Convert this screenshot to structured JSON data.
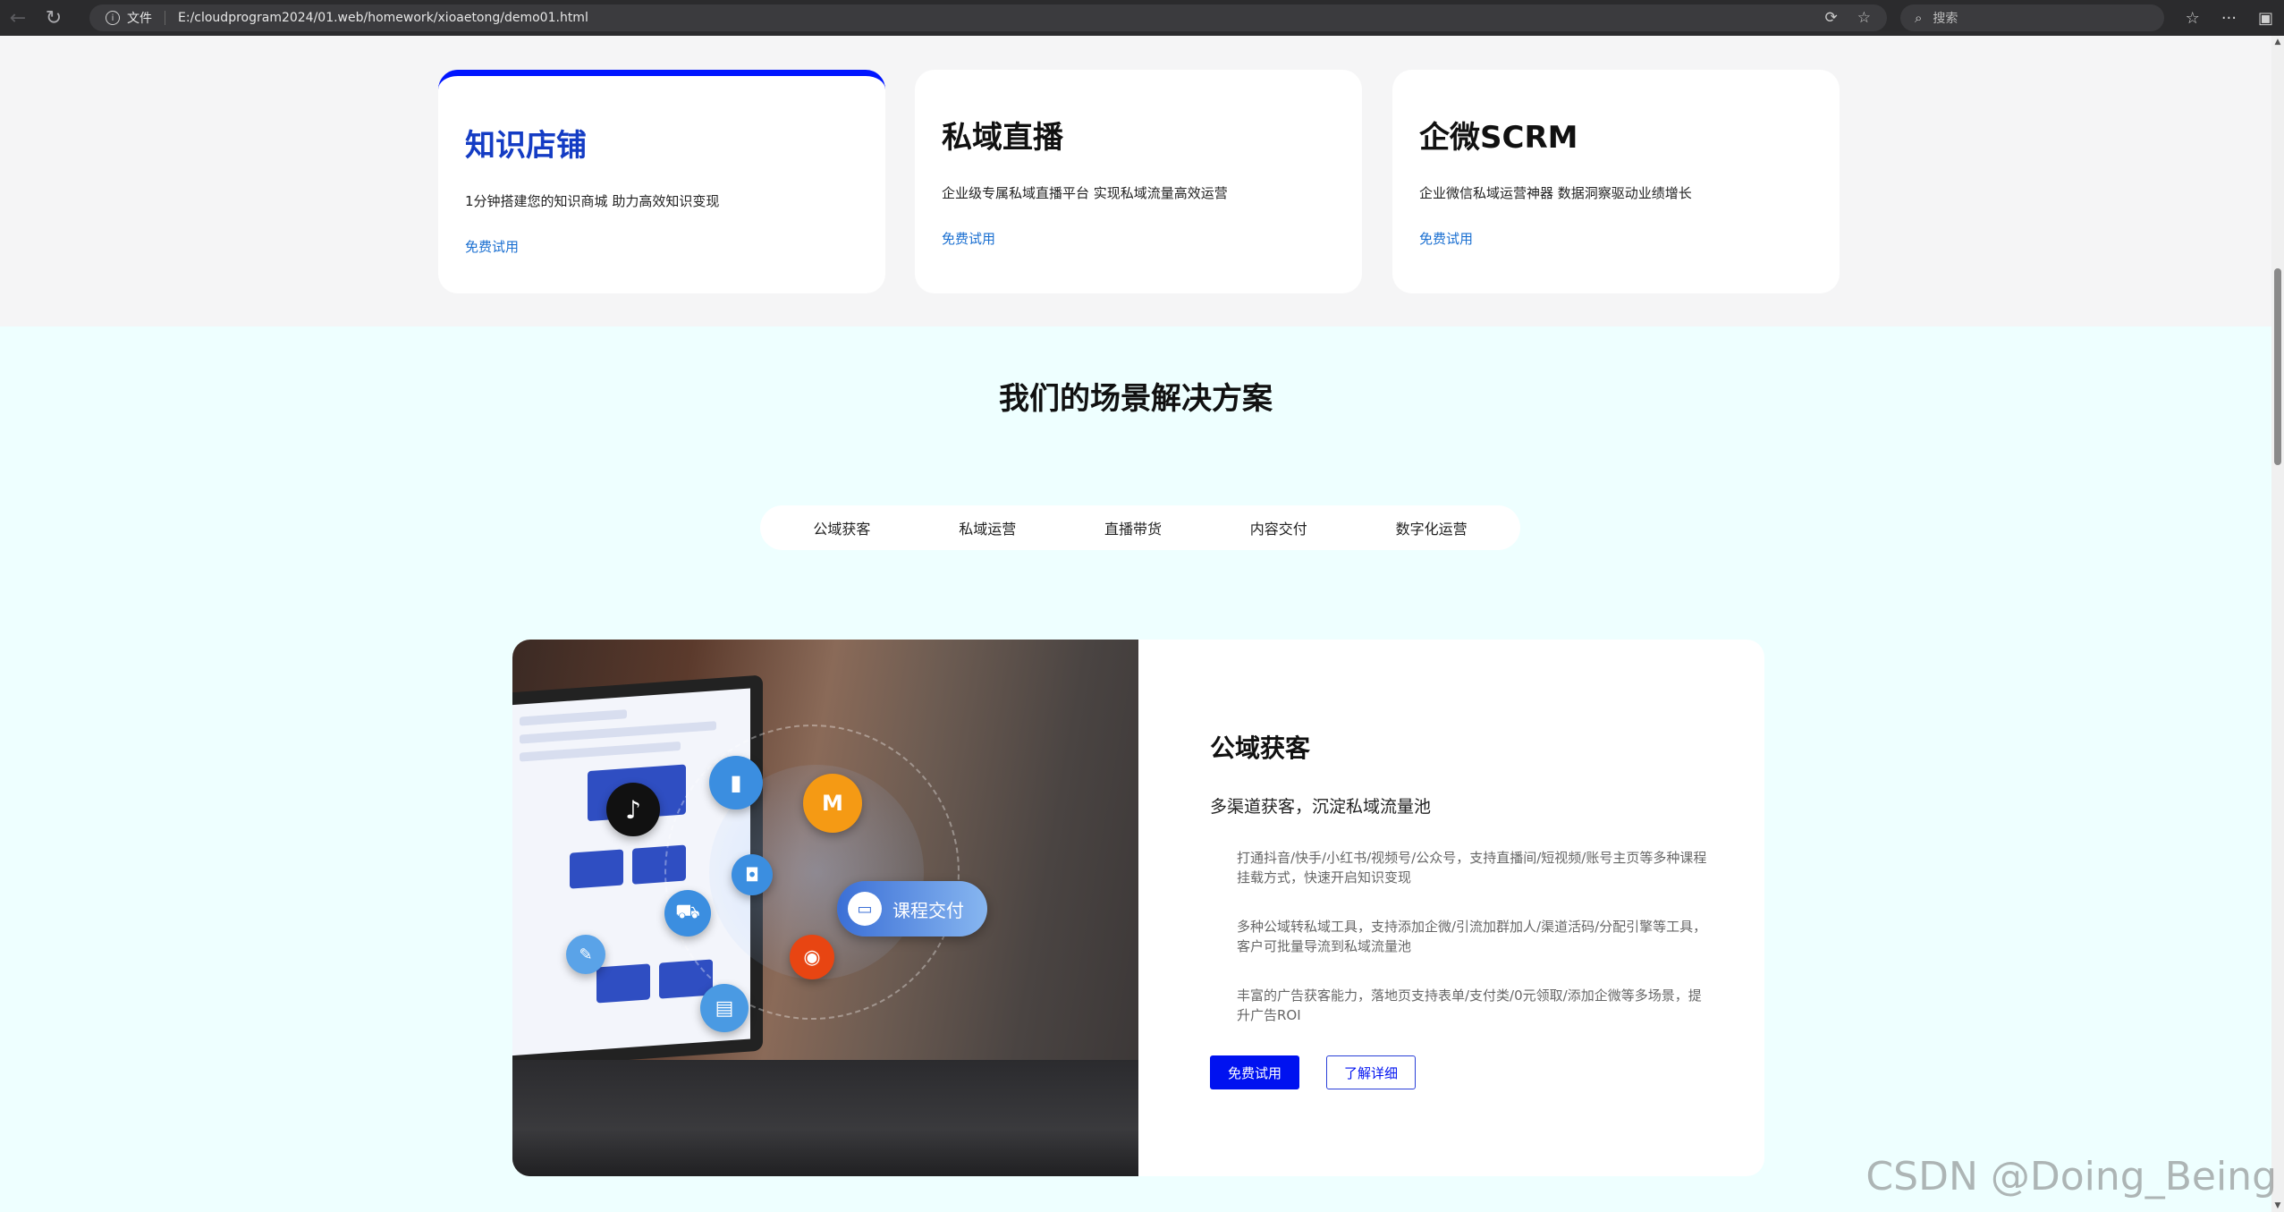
{
  "browser": {
    "file_label": "文件",
    "url": "E:/cloudprogram2024/01.web/homework/xioaetong/demo01.html",
    "search_placeholder": "搜索"
  },
  "products": [
    {
      "title": "知识店铺",
      "desc": "1分钟搭建您的知识商城 助力高效知识变现",
      "link": "免费试用"
    },
    {
      "title": "私域直播",
      "desc": "企业级专属私域直播平台 实现私域流量高效运营",
      "link": "免费试用"
    },
    {
      "title": "企微SCRM",
      "desc": "企业微信私域运营神器 数据洞察驱动业绩增长",
      "link": "免费试用"
    }
  ],
  "scene": {
    "title": "我们的场景解决方案",
    "tabs": [
      "公域获客",
      "私域运营",
      "直播带货",
      "内容交付",
      "数字化运营"
    ],
    "panel": {
      "image_pill": "课程交付",
      "heading": "公域获客",
      "subtitle": "多渠道获客，沉淀私域流量池",
      "descriptions": [
        "打通抖音/快手/小红书/视频号/公众号，支持直播间/短视频/账号主页等多种课程挂载方式，快速开启知识变现",
        "多种公域转私域工具，支持添加企微/引流加群加人/渠道活码/分配引擎等工具，客户可批量导流到私域流量池",
        "丰富的广告获客能力，落地页支持表单/支付类/0元领取/添加企微等多场景，提升广告ROI"
      ],
      "primary_button": "免费试用",
      "secondary_button": "了解详细"
    }
  },
  "watermark": "CSDN @Doing_Being",
  "colors": {
    "accent": "#0012f0",
    "link": "#1a6fd1",
    "scene_bg": "#eeffff",
    "active_title": "#143cc4"
  }
}
